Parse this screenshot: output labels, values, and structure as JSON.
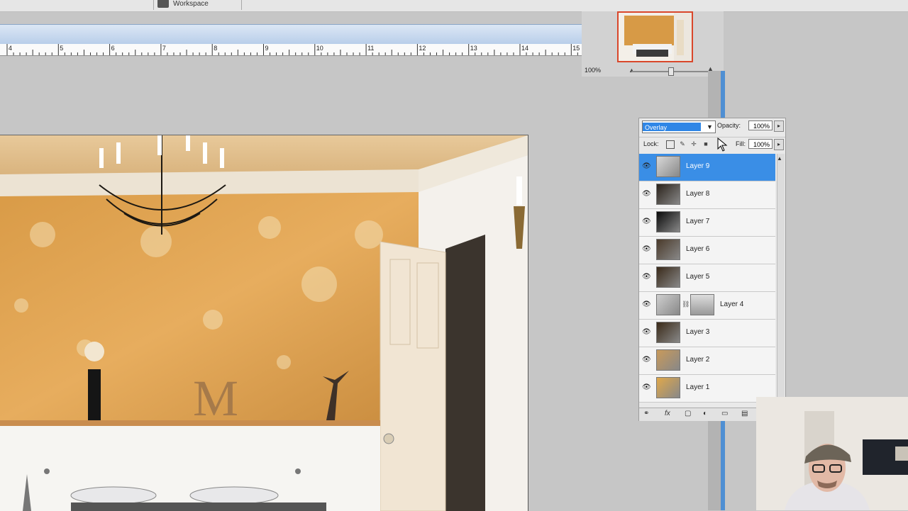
{
  "toolbar": {
    "workspace_label": "Workspace"
  },
  "ruler": {
    "numbers": [
      "4",
      "5",
      "6",
      "7",
      "8",
      "9",
      "10",
      "11",
      "12",
      "13",
      "14",
      "15"
    ]
  },
  "navigator": {
    "zoom": "100%",
    "zoom_out": "▲",
    "zoom_in": "▲"
  },
  "layers_panel": {
    "blend_mode": "Overlay",
    "opacity_label": "Opacity:",
    "opacity_value": "100%",
    "lock_label": "Lock:",
    "fill_label": "Fill:",
    "fill_value": "100%",
    "layers": [
      {
        "name": "Layer 9",
        "selected": true
      },
      {
        "name": "Layer 8",
        "selected": false
      },
      {
        "name": "Layer 7",
        "selected": false
      },
      {
        "name": "Layer 6",
        "selected": false
      },
      {
        "name": "Layer 5",
        "selected": false
      },
      {
        "name": "Layer 4",
        "selected": false,
        "has_mask": true
      },
      {
        "name": "Layer 3",
        "selected": false
      },
      {
        "name": "Layer 2",
        "selected": false
      },
      {
        "name": "Layer 1",
        "selected": false
      }
    ]
  },
  "colors": {
    "selection": "#3a8ee6",
    "nav_frame": "#d9472b",
    "wall": "#e2a954"
  }
}
